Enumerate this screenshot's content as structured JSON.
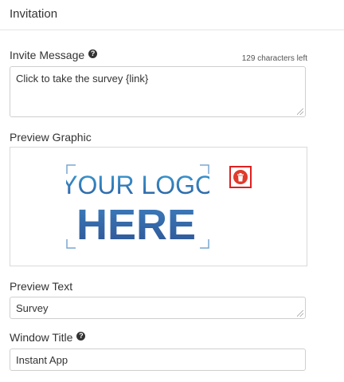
{
  "section": {
    "title": "Invitation"
  },
  "invite_message": {
    "label": "Invite Message",
    "chars_left": "129 characters left",
    "value": "Click to take the survey {link}"
  },
  "preview_graphic": {
    "label": "Preview Graphic",
    "logo_line1": "YOUR LOGO",
    "logo_line2": "HERE",
    "delete_icon": "trash-icon",
    "delete_color": "#e03a2a"
  },
  "preview_text": {
    "label": "Preview Text",
    "value": "Survey"
  },
  "window_title": {
    "label": "Window Title",
    "value": "Instant App"
  },
  "colors": {
    "logo_light": "#3b9bd4",
    "logo_dark": "#2d5fa0",
    "highlight": "#e02020"
  }
}
